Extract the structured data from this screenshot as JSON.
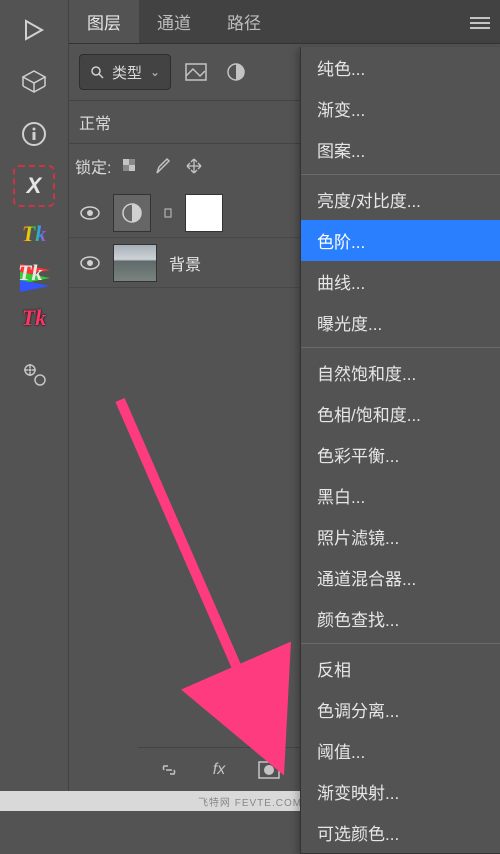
{
  "left_tools": {
    "play": "play-icon",
    "cube": "cube-icon",
    "info": "info-icon",
    "x_sel": "x-selection-icon",
    "tk1": "Tk",
    "tk2": "Tk",
    "tk3": "Tk",
    "clone": "clone-source-icon"
  },
  "tabs": {
    "layers": "图层",
    "channels": "通道",
    "paths": "路径"
  },
  "filter": {
    "type_label": "类型"
  },
  "blend": {
    "mode": "正常"
  },
  "lock": {
    "label": "锁定:"
  },
  "layer_rows": {
    "adjustment_name": "",
    "background_name": "背景"
  },
  "menu": {
    "solid_color": "纯色...",
    "gradient": "渐变...",
    "pattern": "图案...",
    "brightness": "亮度/对比度...",
    "levels": "色阶...",
    "curves": "曲线...",
    "exposure": "曝光度...",
    "vibrance": "自然饱和度...",
    "hue": "色相/饱和度...",
    "color_balance": "色彩平衡...",
    "bw": "黑白...",
    "photo_filter": "照片滤镜...",
    "channel_mixer": "通道混合器...",
    "color_lookup": "颜色查找...",
    "invert": "反相",
    "posterize": "色调分离...",
    "threshold": "阈值...",
    "gradient_map": "渐变映射...",
    "selective_color": "可选颜色..."
  },
  "watermark": "飞特网  FEVTE.COM"
}
